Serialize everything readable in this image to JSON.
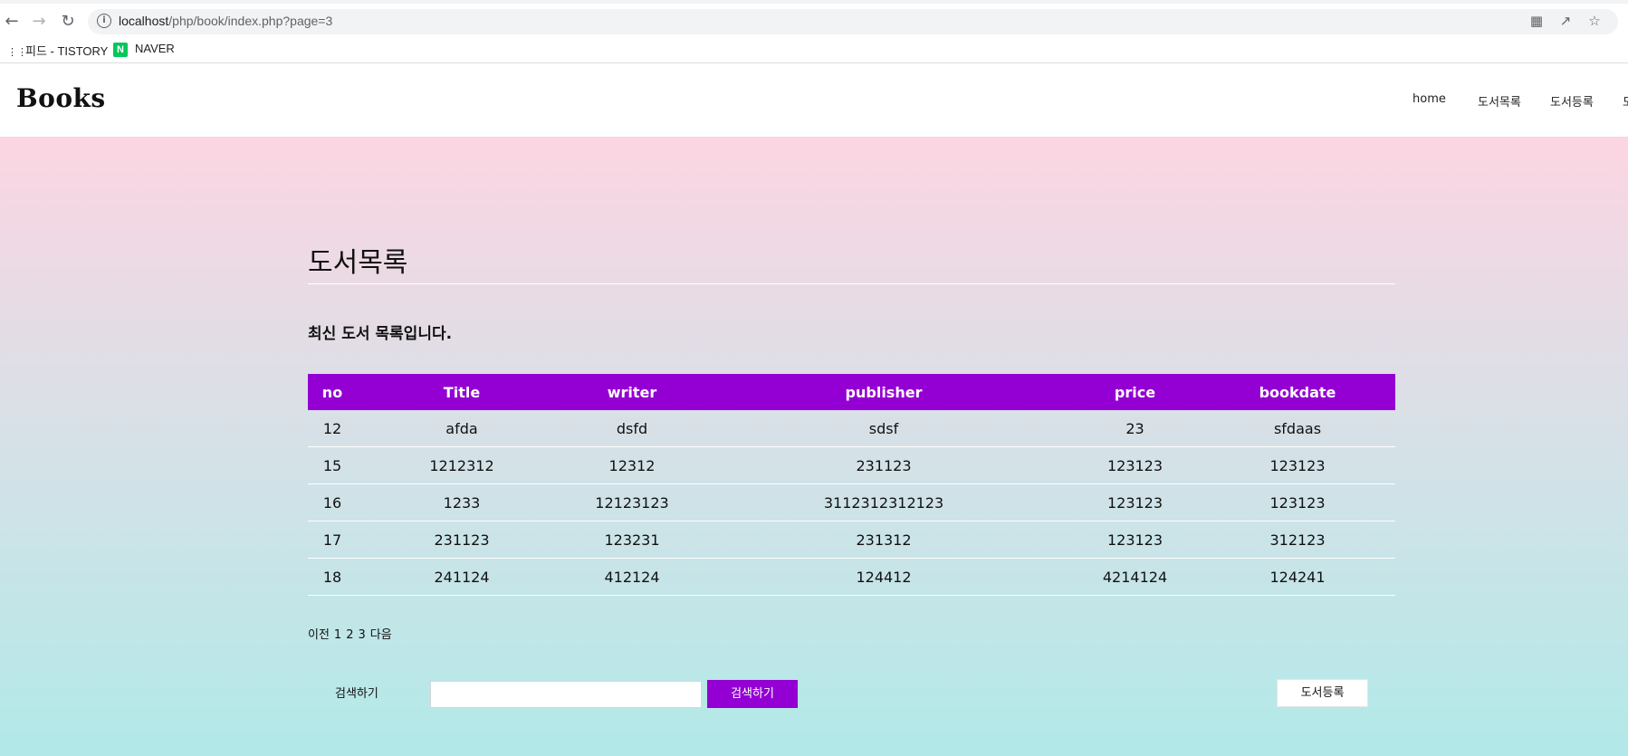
{
  "browser": {
    "back_icon": "arrow-left-icon",
    "forward_icon": "arrow-right-icon",
    "reload_icon": "reload-icon",
    "url_host": "localhost",
    "url_path": "/php/book/index.php?page=3",
    "bookmarks": [
      {
        "label": "피드 - TISTORY",
        "icon": "tistory-icon"
      },
      {
        "label": "NAVER",
        "icon": "naver-icon",
        "icon_letter": "N",
        "color": "#03c75a"
      }
    ]
  },
  "site": {
    "logo": "Books",
    "nav": [
      "home",
      "도서목록",
      "도서등록",
      "도"
    ]
  },
  "main": {
    "title": "도서목록",
    "subtitle": "최신 도서 목록입니다.",
    "accent_color": "#9400d3",
    "table": {
      "headers": [
        "no",
        "Title",
        "writer",
        "publisher",
        "price",
        "bookdate"
      ],
      "rows": [
        [
          "12",
          "afda",
          "dsfd",
          "sdsf",
          "23",
          "sfdaas"
        ],
        [
          "15",
          "1212312",
          "12312",
          "231123",
          "123123",
          "123123"
        ],
        [
          "16",
          "1233",
          "12123123",
          "3112312312123",
          "123123",
          "123123"
        ],
        [
          "17",
          "231123",
          "123231",
          "231312",
          "123123",
          "312123"
        ],
        [
          "18",
          "241124",
          "412124",
          "124412",
          "4214124",
          "124241"
        ]
      ]
    },
    "pagination": {
      "prev": "이전",
      "pages": [
        "1",
        "2",
        "3"
      ],
      "next": "다음"
    },
    "search": {
      "label": "검색하기",
      "value": "",
      "button": "검색하기"
    },
    "register_button": "도서등록"
  }
}
